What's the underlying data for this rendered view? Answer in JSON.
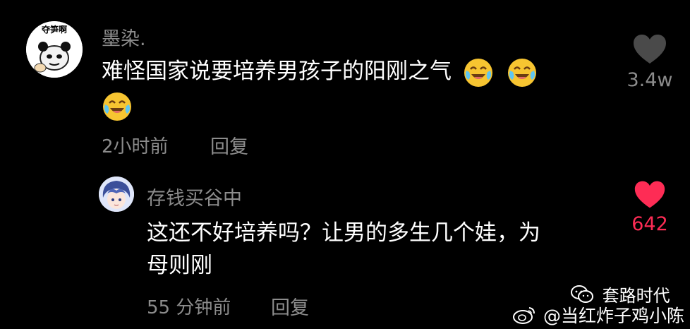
{
  "comments": [
    {
      "username": "墨染.",
      "text_line1": "难怪国家说要培养男孩子的阳刚之气",
      "emoji_icon": "crying-laughing-emoji-icon",
      "time": "2小时前",
      "reply_label": "回复",
      "like_count": "3.4w",
      "liked": false,
      "avatar_caption": "夺笋啊",
      "avatar_icon": "panda-meme-avatar-icon"
    },
    {
      "username": "存钱买谷中",
      "text_line1": "这还不好培养吗？让男的多生几个娃，为",
      "text_line2": "母则刚",
      "time": "55 分钟前",
      "reply_label": "回复",
      "like_count": "642",
      "liked": true,
      "avatar_icon": "anime-character-avatar-icon"
    }
  ],
  "watermark": {
    "wechat_account": "套路时代",
    "weibo_account": "@当红炸子鸡小陈",
    "wechat_icon": "wechat-icon",
    "weibo_icon": "weibo-icon"
  },
  "colors": {
    "background": "#000000",
    "text_primary": "#ffffff",
    "text_secondary": "#8c8c8c",
    "heart_liked": "#fe2c55",
    "heart_unliked": "#4a4a4a",
    "like_count_liked": "#fe2c55",
    "like_count_unliked": "#8c8c8c"
  }
}
